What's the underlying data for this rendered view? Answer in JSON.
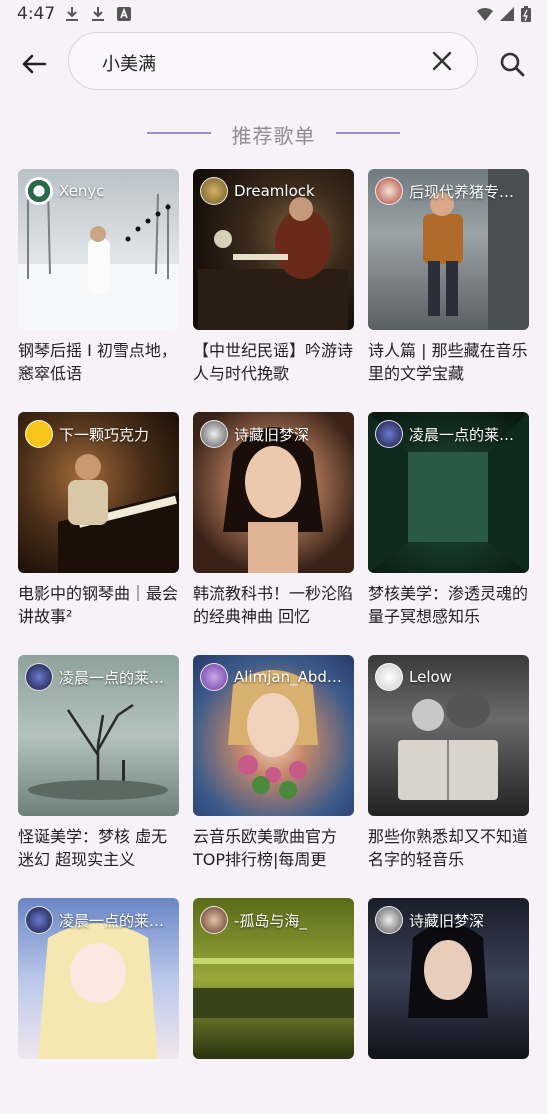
{
  "status_bar": {
    "time": "4:47",
    "left_icons": [
      "download-icon",
      "download-icon",
      "font-icon"
    ],
    "right_icons": [
      "wifi-icon",
      "signal-icon",
      "battery-icon"
    ]
  },
  "search": {
    "query": "小美满",
    "back_icon": "back-arrow-icon",
    "clear_icon": "close-icon",
    "search_icon": "search-icon"
  },
  "section": {
    "title": "推荐歌单",
    "accent": "#9a8fc4"
  },
  "playlists": [
    {
      "owner": "Xenyc",
      "title": "钢琴后摇 I 初雪点地，窸窣低语"
    },
    {
      "owner": "Dreamlock",
      "title": "【中世纪民谣】吟游诗人与时代挽歌"
    },
    {
      "owner": "后现代养猪专…",
      "title": "诗人篇 | 那些藏在音乐里的文学宝藏"
    },
    {
      "owner": "下一颗巧克力",
      "title": "电影中的钢琴曲｜最会讲故事²"
    },
    {
      "owner": "诗藏旧梦深",
      "title": "韩流教科书！一秒沦陷的经典神曲 回忆"
    },
    {
      "owner": "凌晨一点的莱…",
      "title": "梦核美学：渗透灵魂的量子冥想感知乐"
    },
    {
      "owner": "凌晨一点的莱…",
      "title": "怪诞美学：梦核 虚无 迷幻 超现实主义"
    },
    {
      "owner": "Alimjan_Abdu…",
      "title": "云音乐欧美歌曲官方TOP排行榜|每周更"
    },
    {
      "owner": "Lelow",
      "title": "那些你熟悉却又不知道名字的轻音乐"
    },
    {
      "owner": "凌晨一点的莱…",
      "title": ""
    },
    {
      "owner": "-孤岛与海_",
      "title": ""
    },
    {
      "owner": "诗藏旧梦深",
      "title": ""
    }
  ]
}
